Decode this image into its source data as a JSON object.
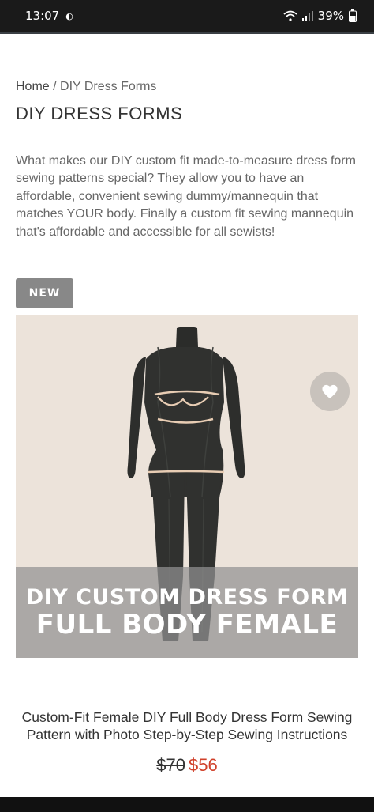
{
  "status_bar": {
    "time": "13:07",
    "battery_percent": "39%"
  },
  "breadcrumb": {
    "home": "Home",
    "separator": " / ",
    "current": "DIY Dress Forms"
  },
  "page_title": "DIY DRESS FORMS",
  "intro_text": "What makes our DIY custom fit made-to-measure dress form sewing patterns special? They allow you to have an affordable, convenient sewing dummy/mannequin that matches YOUR body. Finally a custom fit sewing mannequin that's affordable and accessible for all sewists!",
  "product": {
    "badge": "NEW",
    "image_overlay_line1": "DIY CUSTOM DRESS FORM",
    "image_overlay_line2": "FULL BODY FEMALE",
    "title": "Custom-Fit Female DIY Full Body Dress Form Sewing Pattern with Photo Step-by-Step Sewing Instructions",
    "price_old": "$70",
    "price_new": "$56",
    "wishlist_icon": "heart-icon"
  },
  "colors": {
    "image_background": "#ece3da",
    "form_fabric": "#2f302e",
    "sale_price": "#d0402a",
    "badge": "#888888"
  }
}
